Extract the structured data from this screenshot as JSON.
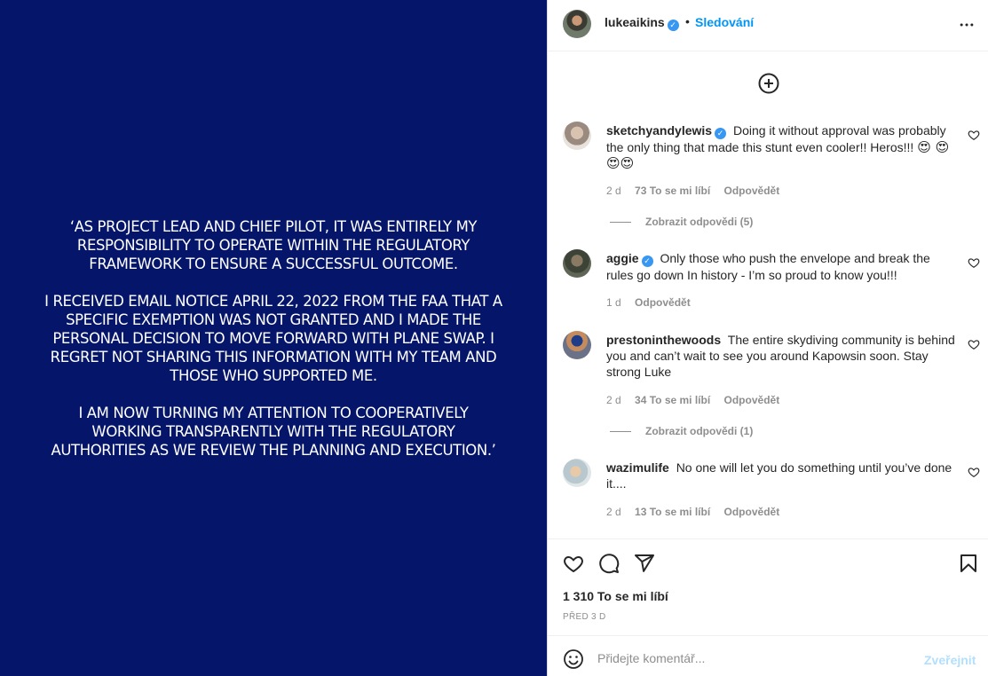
{
  "media": {
    "paragraphs": [
      "‘As project lead and chief pilot, it was entirely my responsibility to operate within the regulatory framework to ensure a successful outcome.",
      "I received email notice April 22, 2022 from the FAA that a specific exemption was not granted and I made the personal decision to move forward with plane swap. I regret not sharing this information with my team and those who supported me.",
      "I am now turning my attention to cooperatively working transparently with the regulatory authorities as we review the planning and execution.’"
    ]
  },
  "header": {
    "username": "lukeaikins",
    "verified": true,
    "dot": "•",
    "follow_label": "Sledování",
    "icons": {
      "more": "more-horizontal-icon",
      "verified": "verified-badge-icon"
    }
  },
  "load_more_icon": "plus-circle-icon",
  "comments": [
    {
      "username": "sketchyandylewis",
      "verified": true,
      "text": "Doing it without approval was probably the only thing that made this stunt even cooler!! Heros!!!",
      "emojis": "😍 😍😍😍",
      "age": "2 d",
      "likes": "73 To se mi líbí",
      "reply": "Odpovědět",
      "replies": "Zobrazit odpovědi (5)"
    },
    {
      "username": "aggie",
      "verified": true,
      "text": "Only those who push the envelope and break the rules go down In history - I’m so proud to know you!!!",
      "age": "1 d",
      "reply": "Odpovědět"
    },
    {
      "username": "prestoninthewoods",
      "verified": false,
      "text": "The entire skydiving community is behind you and can’t wait to see you around Kapowsin soon. Stay strong Luke",
      "age": "2 d",
      "likes": "34 To se mi líbí",
      "reply": "Odpovědět",
      "replies": "Zobrazit odpovědi (1)"
    },
    {
      "username": "wazimulife",
      "verified": false,
      "text": "No one will let you do something until you’ve done it....",
      "age": "2 d",
      "likes": "13 To se mi líbí",
      "reply": "Odpovědět"
    }
  ],
  "actions": {
    "likes_count": "1 310 To se mi líbí",
    "posted": "PŘED 3 D",
    "icons": [
      "heart-icon",
      "comment-icon",
      "share-icon",
      "bookmark-icon"
    ]
  },
  "comment_box": {
    "placeholder": "Přidejte komentář...",
    "post_label": "Zveřejnit"
  },
  "colors": {
    "media_bg": "#04156a",
    "link_blue": "#0095f6",
    "post_disabled": "#b2dffc",
    "secondary_text": "#8e8e8e"
  }
}
